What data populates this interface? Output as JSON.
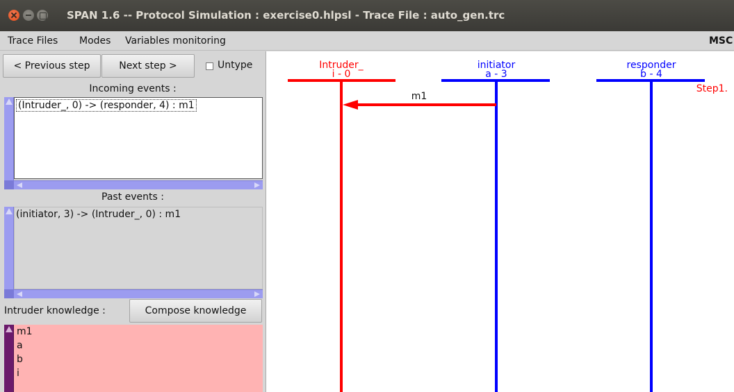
{
  "window": {
    "title": "SPAN 1.6 -- Protocol Simulation : exercise0.hlpsl - Trace File : auto_gen.trc"
  },
  "menu": {
    "items": [
      "Trace Files",
      "Modes",
      "Variables monitoring"
    ],
    "right_label": "MSC"
  },
  "controls": {
    "previous_label": "< Previous step",
    "next_label": "Next step >",
    "untype_label": "Untype",
    "untype_checked": false
  },
  "incoming": {
    "heading": "Incoming events :",
    "items": [
      "(Intruder_, 0) -> (responder, 4) : m1"
    ]
  },
  "past": {
    "heading": "Past events :",
    "items": [
      "(initiator, 3) -> (Intruder_, 0) : m1"
    ]
  },
  "knowledge": {
    "label": "Intruder knowledge :",
    "compose_label": "Compose knowledge",
    "items": [
      "m1",
      "a",
      "b",
      "i"
    ],
    "background": "#ffb3b3"
  },
  "msc": {
    "participants": [
      {
        "name": "Intruder_",
        "id": "i - 0",
        "color": "#ff0000"
      },
      {
        "name": "initiator",
        "id": "a - 3",
        "color": "#0000ff"
      },
      {
        "name": "responder",
        "id": "b - 4",
        "color": "#0000ff"
      }
    ],
    "messages": [
      {
        "from": "initiator",
        "to": "Intruder_",
        "label": "m1",
        "color": "#ff0000"
      }
    ],
    "step_label": "Step1.",
    "step_color": "#ff0000"
  }
}
